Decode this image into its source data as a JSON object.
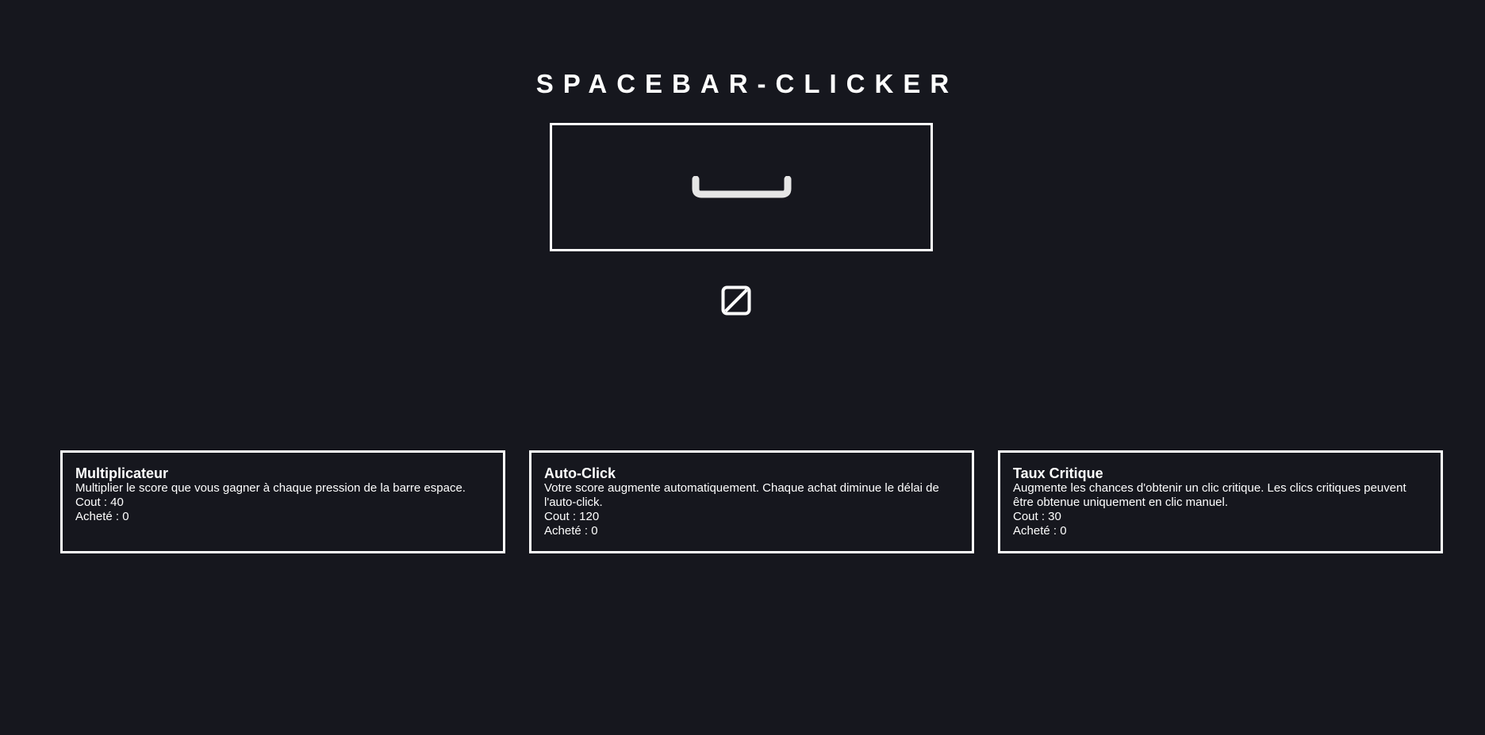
{
  "app": {
    "title": "SPACEBAR-CLICKER"
  },
  "main": {
    "space_key_icon": "spacebar-icon",
    "toggle_icon": "square-slash-icon"
  },
  "shop": {
    "items": [
      {
        "title": "Multiplicateur",
        "description": "Multiplier le score que vous gagner à chaque pression de la barre espace.",
        "cost": "Cout : 40",
        "bought": "Acheté : 0"
      },
      {
        "title": "Auto-Click",
        "description": "Votre score augmente automatiquement. Chaque achat diminue le délai de l'auto-click.",
        "cost": "Cout : 120",
        "bought": "Acheté : 0"
      },
      {
        "title": "Taux Critique",
        "description": "Augmente les chances d'obtenir un clic critique. Les clics critiques peuvent être obtenue uniquement en clic manuel.",
        "cost": "Cout : 30",
        "bought": "Acheté : 0"
      }
    ]
  },
  "colors": {
    "background": "#16171e",
    "foreground": "#ffffff",
    "key_icon": "#e6e6e6"
  }
}
